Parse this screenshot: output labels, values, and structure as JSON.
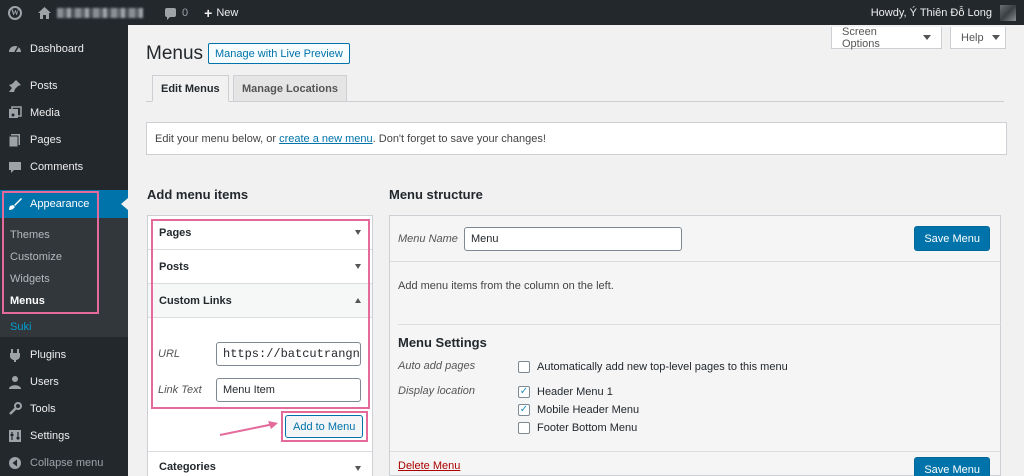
{
  "adminbar": {
    "new_count": "0",
    "new_label": "New",
    "howdy": "Howdy, Ý Thiên Đỗ Long"
  },
  "sidebar": {
    "items": [
      {
        "label": "Dashboard",
        "icon": "dashboard-icon"
      },
      {
        "label": "Posts",
        "icon": "pin-icon"
      },
      {
        "label": "Media",
        "icon": "media-icon"
      },
      {
        "label": "Pages",
        "icon": "pages-icon"
      },
      {
        "label": "Comments",
        "icon": "comments-icon"
      },
      {
        "label": "Appearance",
        "icon": "brush-icon"
      }
    ],
    "submenu": [
      "Themes",
      "Customize",
      "Widgets",
      "Menus"
    ],
    "suki": "Suki",
    "items_after": [
      {
        "label": "Plugins",
        "icon": "plugin-icon"
      },
      {
        "label": "Users",
        "icon": "users-icon"
      },
      {
        "label": "Tools",
        "icon": "tools-icon"
      },
      {
        "label": "Settings",
        "icon": "settings-icon"
      },
      {
        "label": "Collapse menu",
        "icon": "collapse-icon"
      }
    ]
  },
  "header": {
    "screen_options": "Screen Options",
    "help": "Help",
    "title": "Menus",
    "live_preview": "Manage with Live Preview",
    "tabs": [
      "Edit Menus",
      "Manage Locations"
    ]
  },
  "notice": {
    "before": "Edit your menu below, or",
    "link": "create a new menu",
    "after": ". Don't forget to save your changes!"
  },
  "add_items": {
    "heading": "Add menu items",
    "sections": [
      "Pages",
      "Posts",
      "Custom Links",
      "Categories"
    ],
    "url_label": "URL",
    "url_value": "https://batcutrangnc",
    "link_text_label": "Link Text",
    "link_text_value": "Menu Item",
    "add_button": "Add to Menu"
  },
  "structure": {
    "heading": "Menu structure",
    "menu_name_label": "Menu Name",
    "menu_name_value": "Menu",
    "save_button": "Save Menu",
    "hint": "Add menu items from the column on the left.",
    "settings_title": "Menu Settings",
    "auto_add_label": "Auto add pages",
    "auto_add_option": "Automatically add new top-level pages to this menu",
    "display_location_label": "Display location",
    "locations": [
      {
        "label": "Header Menu 1",
        "checked": true
      },
      {
        "label": "Mobile Header Menu",
        "checked": true
      },
      {
        "label": "Footer Bottom Menu",
        "checked": false
      }
    ],
    "delete_link": "Delete Menu"
  },
  "colors": {
    "accent": "#0073aa",
    "highlight": "#e36a9a",
    "adminbar": "#23282d"
  }
}
